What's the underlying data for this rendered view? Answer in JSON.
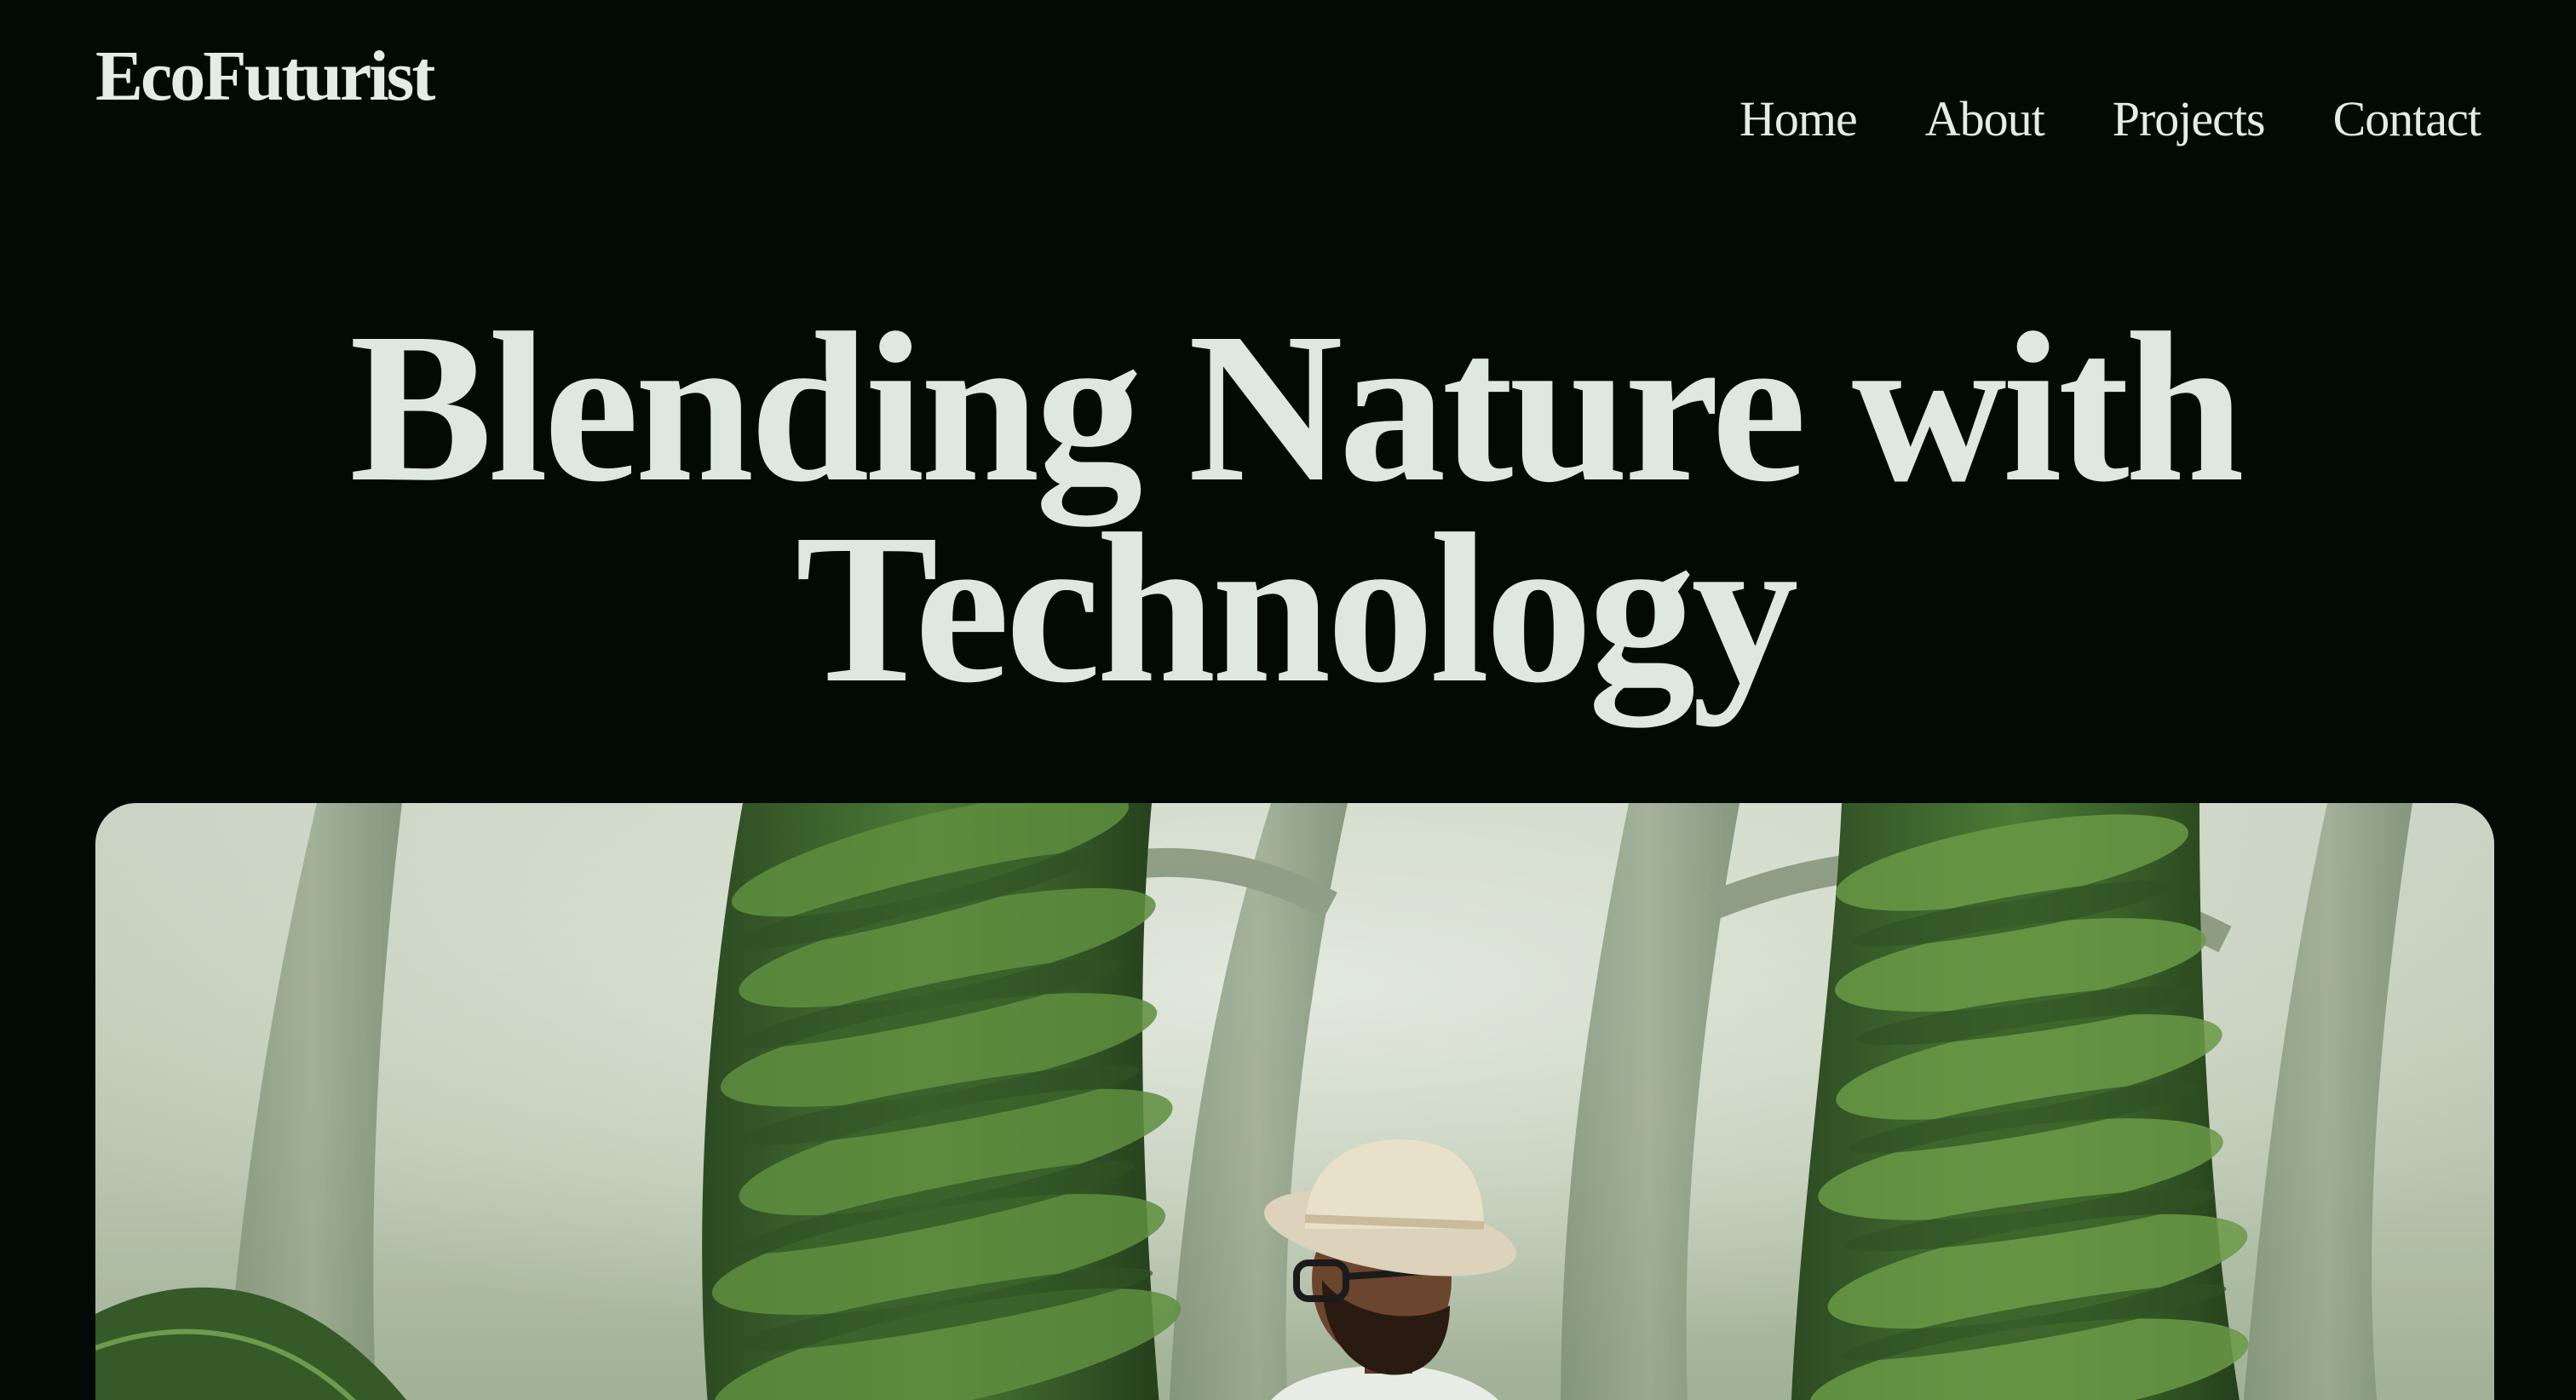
{
  "header": {
    "logo": "EcoFuturist",
    "nav": [
      {
        "label": "Home"
      },
      {
        "label": "About"
      },
      {
        "label": "Projects"
      },
      {
        "label": "Contact"
      }
    ]
  },
  "hero": {
    "title": "Blending Nature with Technology"
  },
  "colors": {
    "background": "#020a05",
    "text": "#dde8e1",
    "foliage": "#3e6a2b",
    "mist": "#cfd8c8"
  }
}
